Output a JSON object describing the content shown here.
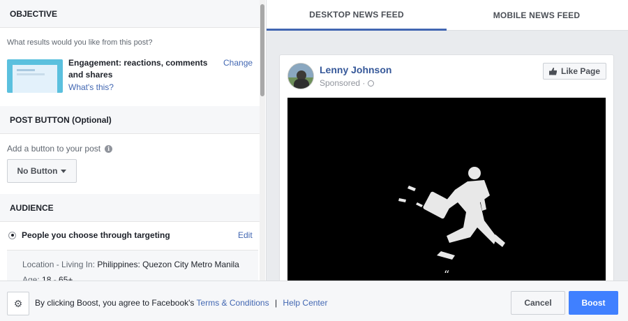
{
  "objective": {
    "heading": "OBJECTIVE",
    "question": "What results would you like from this post?",
    "title": "Engagement: reactions, comments and shares",
    "whats_this": "What's this?",
    "change": "Change"
  },
  "post_button": {
    "heading": "POST BUTTON (Optional)",
    "label": "Add a button to your post",
    "selected": "No Button"
  },
  "audience": {
    "heading": "AUDIENCE",
    "option": "People you choose through targeting",
    "edit": "Edit",
    "location_label": "Location - Living In:",
    "location_value": "Philippines: Quezon City Metro Manila",
    "age_label": "Age:",
    "age_value": "18 - 65+"
  },
  "preview": {
    "tabs": [
      "DESKTOP NEWS FEED",
      "MOBILE NEWS FEED"
    ],
    "author": "Lenny Johnson",
    "sponsored": "Sponsored ·",
    "like_page": "Like Page",
    "quote_mark": "“"
  },
  "footer": {
    "agree_text": "By clicking Boost, you agree to Facebook's",
    "terms": "Terms & Conditions",
    "separator": "|",
    "help": "Help Center",
    "cancel": "Cancel",
    "boost": "Boost"
  },
  "colors": {
    "accent": "#4267b2",
    "boost": "#4080ff",
    "muted": "#606770"
  }
}
